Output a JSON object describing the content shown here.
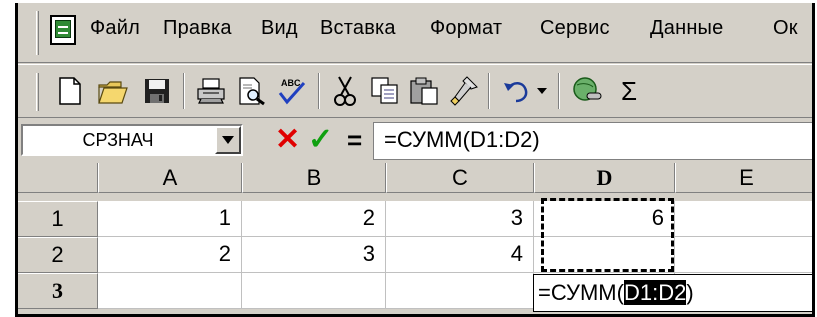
{
  "menu": {
    "items": [
      "Файл",
      "Правка",
      "Вид",
      "Вставка",
      "Формат",
      "Сервис",
      "Данные",
      "Ок"
    ]
  },
  "toolbar": {
    "buttons": [
      {
        "icon": "new-document-icon",
        "label": "Создать"
      },
      {
        "icon": "open-folder-icon",
        "label": "Открыть"
      },
      {
        "icon": "save-icon",
        "label": "Сохранить"
      },
      {
        "icon": "print-icon",
        "label": "Печать"
      },
      {
        "icon": "print-preview-icon",
        "label": "Предварительный просмотр"
      },
      {
        "icon": "spelling-icon",
        "label": "Орфография"
      },
      {
        "icon": "cut-icon",
        "label": "Вырезать"
      },
      {
        "icon": "copy-icon",
        "label": "Копировать"
      },
      {
        "icon": "paste-icon",
        "label": "Вставить"
      },
      {
        "icon": "format-painter-icon",
        "label": "Формат по образцу"
      },
      {
        "icon": "undo-icon",
        "label": "Отменить"
      },
      {
        "icon": "hyperlink-icon",
        "label": "Гиперссылка"
      },
      {
        "icon": "autosum-icon",
        "label": "Σ"
      }
    ],
    "spelling_text": "ABC",
    "autosum_text": "Σ"
  },
  "formula_bar": {
    "name_box": "СРЗНАЧ",
    "cancel": "✕",
    "enter": "✓",
    "equals": "=",
    "formula": "=СУММ(D1:D2)"
  },
  "grid": {
    "columns": [
      "A",
      "B",
      "C",
      "D",
      "E"
    ],
    "active_column": "D",
    "rows": [
      {
        "label": "1",
        "cells": [
          "1",
          "2",
          "3",
          "6",
          ""
        ]
      },
      {
        "label": "2",
        "cells": [
          "2",
          "3",
          "4",
          "",
          ""
        ]
      },
      {
        "label": "3",
        "cells": [
          "",
          "",
          "",
          "",
          ""
        ]
      }
    ],
    "active_row": "3",
    "edit": {
      "prefix": "=СУММ(",
      "selected": "D1:D2",
      "suffix": ")"
    }
  },
  "colors": {
    "chrome": "#d4d0c8",
    "cancel": "#e00000",
    "enter": "#10a010",
    "excel_icon": "#2f8a34"
  }
}
